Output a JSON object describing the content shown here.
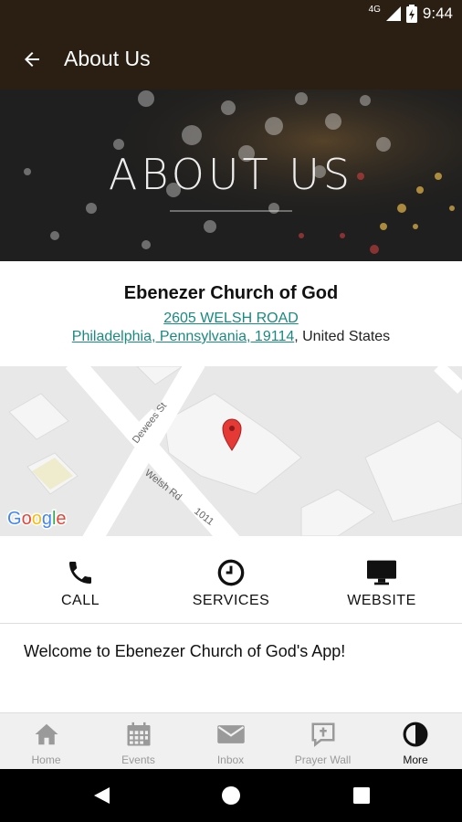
{
  "status_bar": {
    "network": "4G",
    "time": "9:44"
  },
  "app_bar": {
    "title": "About Us"
  },
  "hero": {
    "title": "ABOUT US"
  },
  "church": {
    "name": "Ebenezer Church of God",
    "street": "2605 WELSH ROAD",
    "city_line": "Philadelphia, Pennsylvania, 19114",
    "country": ", United States"
  },
  "map": {
    "street1": "Dewees St",
    "street2": "Welsh Rd",
    "number": "1011",
    "logo": "Google"
  },
  "actions": [
    {
      "label": "CALL",
      "icon": "phone-icon"
    },
    {
      "label": "SERVICES",
      "icon": "clock-icon"
    },
    {
      "label": "WEBSITE",
      "icon": "monitor-icon"
    }
  ],
  "welcome": "Welcome to Ebenezer Church of God's App!",
  "tabs": [
    {
      "label": "Home",
      "icon": "home-icon",
      "active": false
    },
    {
      "label": "Events",
      "icon": "calendar-icon",
      "active": false
    },
    {
      "label": "Inbox",
      "icon": "mail-icon",
      "active": false
    },
    {
      "label": "Prayer Wall",
      "icon": "prayer-icon",
      "active": false
    },
    {
      "label": "More",
      "icon": "contrast-icon",
      "active": true
    }
  ],
  "colors": {
    "app_bar": "#2a1f12",
    "link": "#1a8a80",
    "pin": "#e53935"
  }
}
